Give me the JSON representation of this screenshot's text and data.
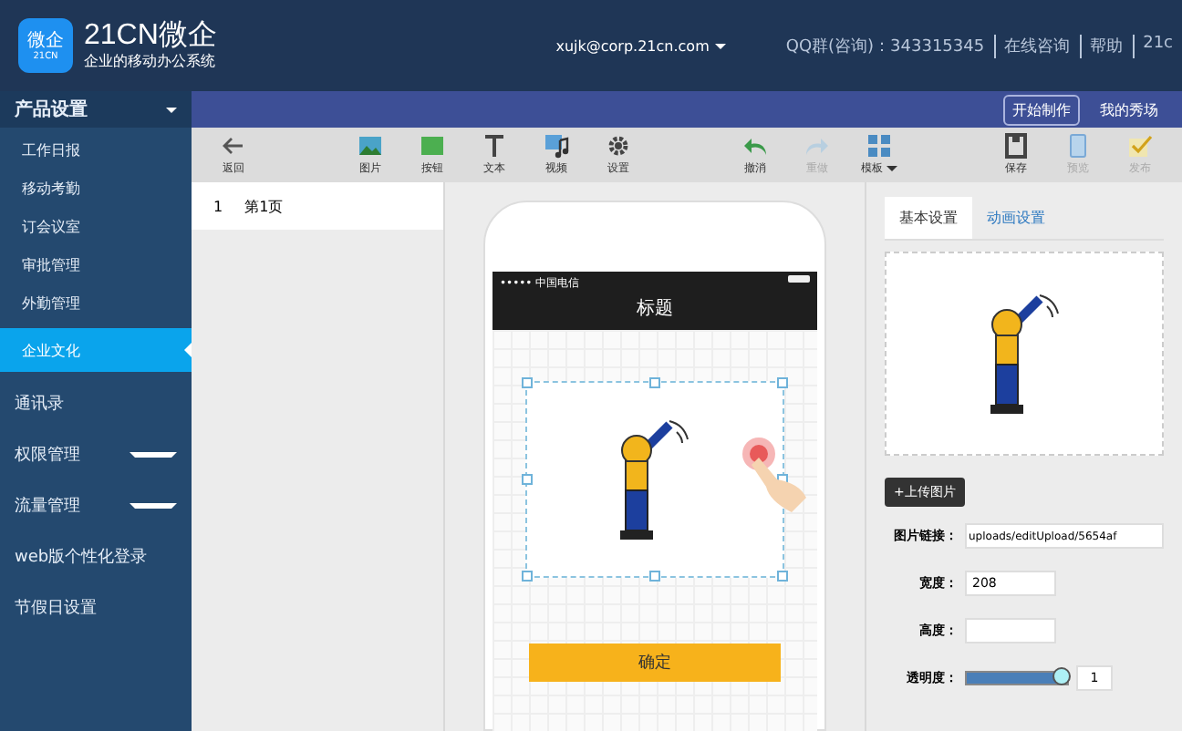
{
  "header": {
    "logo_mark": "微企",
    "logo_sub": "21CN",
    "brand": "21CN微企",
    "tagline": "企业的移动办公系统",
    "user": "xujk@corp.21cn.com",
    "links": [
      "QQ群(咨询)：343315345",
      "在线咨询",
      "帮助",
      "21c"
    ]
  },
  "sidebar": {
    "section": "产品设置",
    "items": [
      {
        "label": "工作日报",
        "kind": "sub",
        "selected": false
      },
      {
        "label": "移动考勤",
        "kind": "sub",
        "selected": false
      },
      {
        "label": "订会议室",
        "kind": "sub",
        "selected": false
      },
      {
        "label": "审批管理",
        "kind": "sub",
        "selected": false
      },
      {
        "label": "外勤管理",
        "kind": "sub",
        "selected": false
      },
      {
        "label": "企业文化",
        "kind": "sub",
        "selected": true
      },
      {
        "label": "通讯录",
        "kind": "top",
        "selected": false
      },
      {
        "label": "权限管理",
        "kind": "group",
        "selected": false
      },
      {
        "label": "流量管理",
        "kind": "group",
        "selected": false
      },
      {
        "label": "web版个性化登录",
        "kind": "top",
        "selected": false
      },
      {
        "label": "节假日设置",
        "kind": "top",
        "selected": false
      }
    ]
  },
  "topbar": {
    "buttons": [
      {
        "label": "开始制作",
        "selected": true
      },
      {
        "label": "我的秀场",
        "selected": false
      }
    ]
  },
  "toolbar": [
    {
      "kind": "back",
      "label": "返回",
      "disabled": false
    },
    {
      "kind": "gap"
    },
    {
      "kind": "image",
      "label": "图片",
      "disabled": false
    },
    {
      "kind": "button",
      "label": "按钮",
      "disabled": false
    },
    {
      "kind": "text",
      "label": "文本",
      "disabled": false
    },
    {
      "kind": "video",
      "label": "视频",
      "disabled": false
    },
    {
      "kind": "settings",
      "label": "设置",
      "disabled": false
    },
    {
      "kind": "gap"
    },
    {
      "kind": "undo",
      "label": "撤消",
      "disabled": false
    },
    {
      "kind": "redo",
      "label": "重做",
      "disabled": true
    },
    {
      "kind": "template",
      "label": "模板",
      "disabled": false
    },
    {
      "kind": "gap"
    },
    {
      "kind": "save",
      "label": "保存",
      "disabled": false
    },
    {
      "kind": "preview",
      "label": "预览",
      "disabled": true
    },
    {
      "kind": "publish",
      "label": "发布",
      "disabled": true
    }
  ],
  "pages": [
    {
      "number": "1",
      "label": "第1页",
      "selected": true
    }
  ],
  "phone": {
    "carrier": "••••• 中国电信",
    "title": "标题",
    "button": "确定"
  },
  "panel": {
    "tabs": [
      {
        "label": "基本设置",
        "selected": true
      },
      {
        "label": "动画设置",
        "selected": false
      }
    ],
    "upload": "+上传图片",
    "fields": [
      {
        "kind": "text",
        "label": "图片链接：",
        "value": "uploads/editUpload/5654af"
      },
      {
        "kind": "number",
        "label": "宽度：",
        "value": "208"
      },
      {
        "kind": "number",
        "label": "高度："
      },
      {
        "kind": "slider",
        "label": "透明度：",
        "level": 0.95,
        "value": "1"
      }
    ]
  }
}
